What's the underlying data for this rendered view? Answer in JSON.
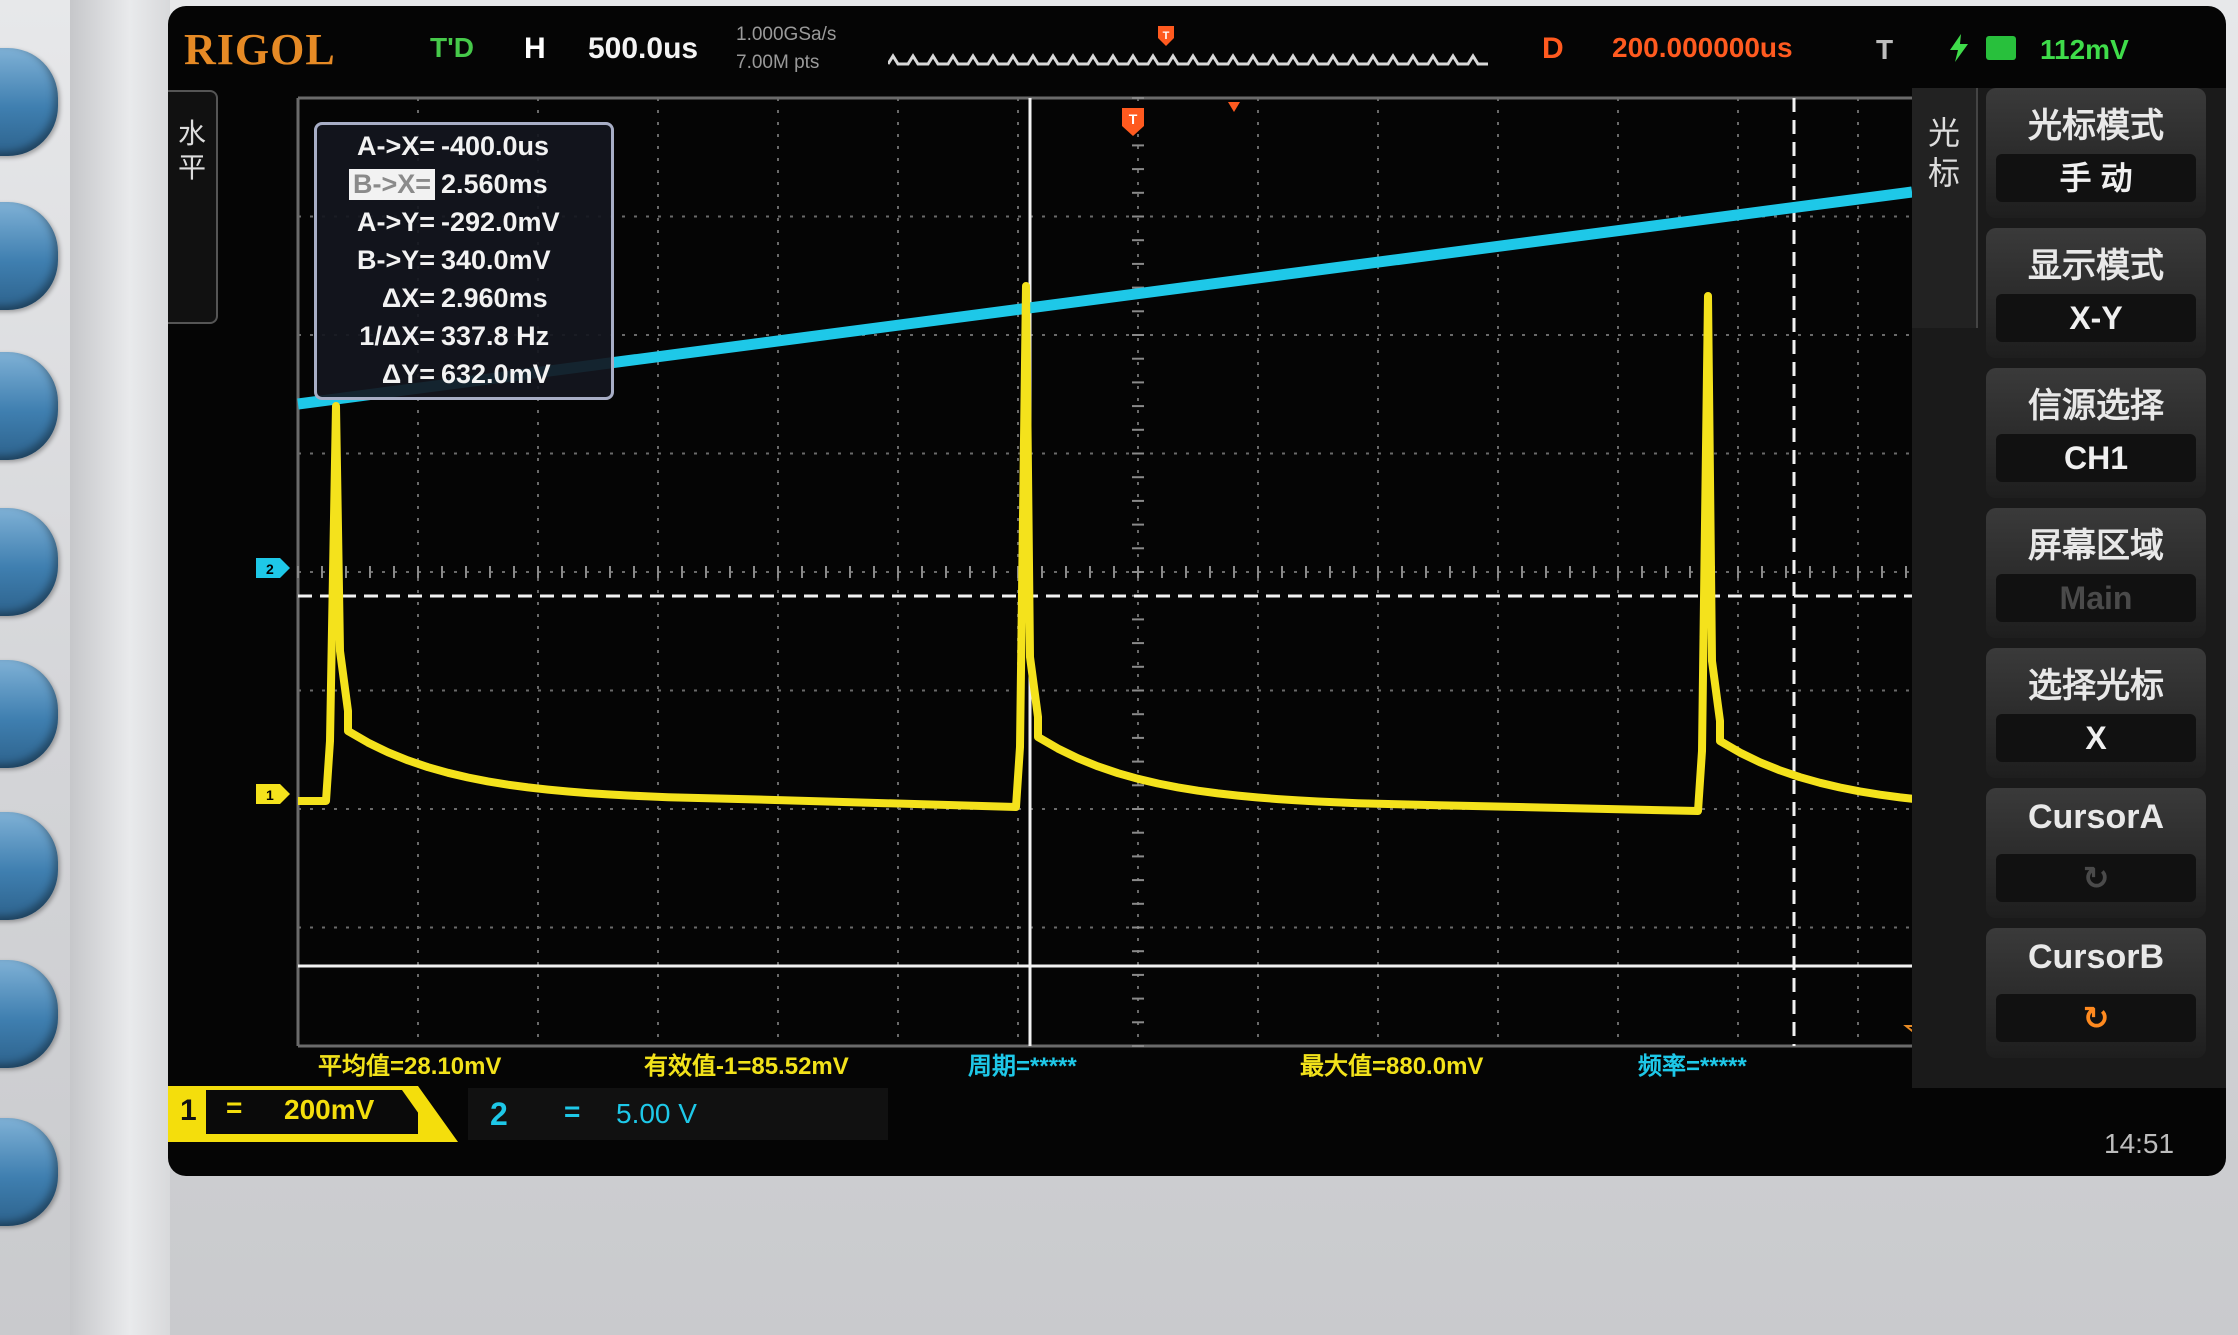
{
  "header": {
    "brand": "RIGOL",
    "trigger_state": "T'D",
    "horizontal_label": "H",
    "timebase": "500.0us",
    "sample_rate": "1.000GSa/s",
    "memory_depth": "7.00M pts",
    "delay_label": "D",
    "delay_value": "200.000000us",
    "trigger_label": "T",
    "trigger_level": "112mV"
  },
  "left_tab": {
    "chars": [
      "水",
      "平"
    ]
  },
  "cursor_readout": [
    {
      "label": "A->X=",
      "value": "-400.0us",
      "highlight": false
    },
    {
      "label": "B->X=",
      "value": "2.560ms",
      "highlight": true
    },
    {
      "label": "A->Y=",
      "value": "-292.0mV",
      "highlight": false
    },
    {
      "label": "B->Y=",
      "value": "340.0mV",
      "highlight": false
    },
    {
      "label": "ΔX=",
      "value": "2.960ms",
      "highlight": false
    },
    {
      "label": "1/ΔX=",
      "value": "337.8 Hz",
      "highlight": false
    },
    {
      "label": "ΔY=",
      "value": "632.0mV",
      "highlight": false
    }
  ],
  "right_menu": {
    "tab_chars": [
      "光",
      "标"
    ],
    "items": [
      {
        "title": "光标模式",
        "value": "手  动",
        "style": "normal"
      },
      {
        "title": "显示模式",
        "value": "X-Y",
        "style": "normal"
      },
      {
        "title": "信源选择",
        "value": "CH1",
        "style": "normal"
      },
      {
        "title": "屏幕区域",
        "value": "Main",
        "style": "dim"
      },
      {
        "title": "选择光标",
        "value": "X",
        "style": "normal"
      },
      {
        "title": "CursorA",
        "value": "↻",
        "style": "dim"
      },
      {
        "title": "CursorB",
        "value": "↻",
        "style": "orange"
      }
    ]
  },
  "measurements": {
    "mean": "平均值=28.10mV",
    "rms": "有效值-1=85.52mV",
    "period": "周期=*****",
    "max": "最大值=880.0mV",
    "freq": "频率=*****"
  },
  "channels": {
    "ch1": {
      "number": "1",
      "coupling": "=",
      "scale": "200mV"
    },
    "ch2": {
      "number": "2",
      "coupling": "=",
      "scale": "5.00 V"
    }
  },
  "clock": "14:51",
  "markers": {
    "ch1": "1",
    "ch2": "2",
    "trigger": "T"
  },
  "colors": {
    "ch1": "#f4e21c",
    "ch2": "#1ec8e8",
    "brand": "#e68a25",
    "delay": "#ff5a1f",
    "trigger_ok": "#46c94a"
  },
  "icons": {
    "trigger_edge": "lightning-rising-edge-icon",
    "trigger_channel": "ch-square-icon",
    "cursor_knob": "rotate-knob-icon",
    "trigger_marker": "trigger-t-marker-icon"
  }
}
